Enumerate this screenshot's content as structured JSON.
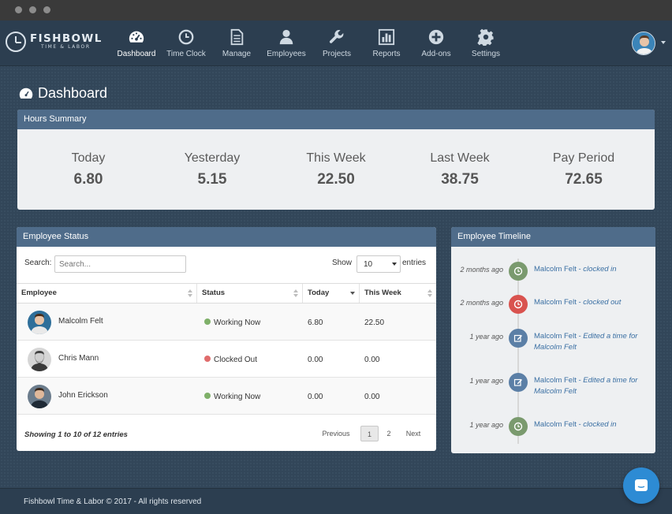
{
  "app": {
    "brand": "FISHBOWL",
    "brand_sub": "TIME & LABOR"
  },
  "nav": {
    "items": [
      {
        "label": "Dashboard",
        "icon": "dashboard-icon",
        "active": true
      },
      {
        "label": "Time Clock",
        "icon": "clock-icon",
        "active": false
      },
      {
        "label": "Manage",
        "icon": "document-icon",
        "active": false
      },
      {
        "label": "Employees",
        "icon": "user-icon",
        "active": false
      },
      {
        "label": "Projects",
        "icon": "wrench-icon",
        "active": false
      },
      {
        "label": "Reports",
        "icon": "bar-chart-icon",
        "active": false
      },
      {
        "label": "Add-ons",
        "icon": "plus-circle-icon",
        "active": false
      },
      {
        "label": "Settings",
        "icon": "gear-icon",
        "active": false
      }
    ]
  },
  "page": {
    "title": "Dashboard"
  },
  "hours_summary": {
    "title": "Hours Summary",
    "periods": [
      {
        "label": "Today",
        "value": "6.80"
      },
      {
        "label": "Yesterday",
        "value": "5.15"
      },
      {
        "label": "This Week",
        "value": "22.50"
      },
      {
        "label": "Last Week",
        "value": "38.75"
      },
      {
        "label": "Pay Period",
        "value": "72.65"
      }
    ]
  },
  "employee_status": {
    "title": "Employee Status",
    "search_label": "Search:",
    "search_placeholder": "Search...",
    "show_label": "Show",
    "show_value": "10",
    "entries_label": "entries",
    "columns": [
      "Employee",
      "Status",
      "Today",
      "This Week"
    ],
    "rows": [
      {
        "name": "Malcolm Felt",
        "status": "Working Now",
        "status_color": "#7fb069",
        "today": "6.80",
        "week": "22.50"
      },
      {
        "name": "Chris Mann",
        "status": "Clocked Out",
        "status_color": "#e06c6c",
        "today": "0.00",
        "week": "0.00"
      },
      {
        "name": "John Erickson",
        "status": "Working Now",
        "status_color": "#7fb069",
        "today": "0.00",
        "week": "0.00"
      }
    ],
    "info": "Showing 1 to 10 of 12 entries",
    "pagination": {
      "previous": "Previous",
      "pages": [
        "1",
        "2"
      ],
      "next": "Next",
      "current": "1"
    }
  },
  "timeline": {
    "title": "Employee Timeline",
    "items": [
      {
        "time": "2 months ago",
        "name": "Malcolm Felt",
        "action": "clocked in",
        "type": "clock-in",
        "color": "#7a9a6e"
      },
      {
        "time": "2 months ago",
        "name": "Malcolm Felt",
        "action": "clocked out",
        "type": "clock-out",
        "color": "#d9534f"
      },
      {
        "time": "1 year ago",
        "name": "Malcolm Felt",
        "action": "Edited a time for Malcolm Felt",
        "type": "edit",
        "color": "#5b7fa6"
      },
      {
        "time": "1 year ago",
        "name": "Malcolm Felt",
        "action": "Edited a time for Malcolm Felt",
        "type": "edit",
        "color": "#5b7fa6"
      },
      {
        "time": "1 year ago",
        "name": "Malcolm Felt",
        "action": "clocked in",
        "type": "clock-in",
        "color": "#7a9a6e"
      }
    ]
  },
  "footer": {
    "text": "Fishbowl Time & Labor © 2017 - All rights reserved"
  },
  "colors": {
    "nav_bg": "#2c3e50",
    "panel_header": "#4f6c8a",
    "accent_link": "#3a6fa3",
    "chat_button": "#2d8bd4"
  }
}
